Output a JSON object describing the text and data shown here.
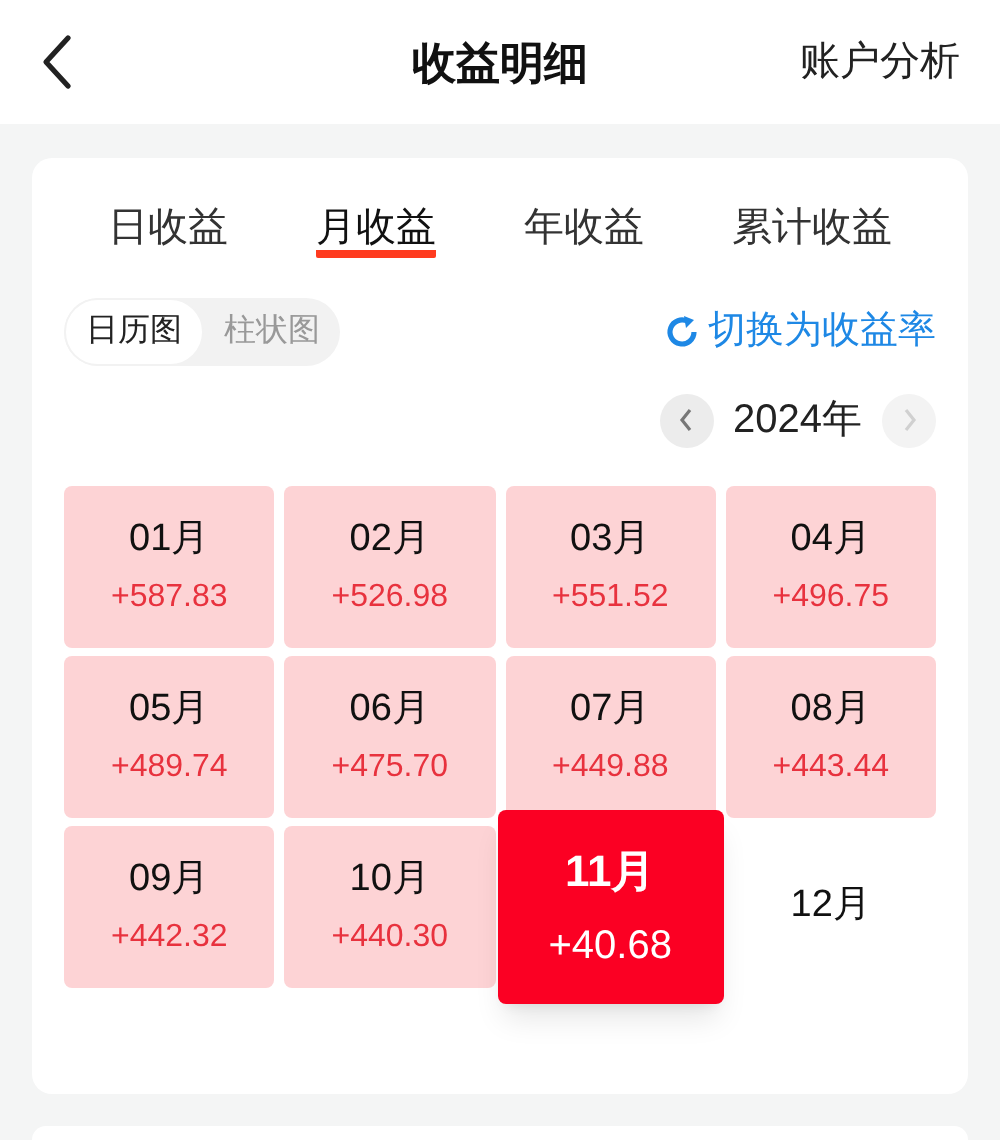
{
  "header": {
    "title": "收益明细",
    "action": "账户分析"
  },
  "tabs": [
    {
      "label": "日收益",
      "selected": false
    },
    {
      "label": "月收益",
      "selected": true
    },
    {
      "label": "年收益",
      "selected": false
    },
    {
      "label": "累计收益",
      "selected": false
    }
  ],
  "view_toggle": [
    {
      "label": "日历图",
      "selected": true
    },
    {
      "label": "柱状图",
      "selected": false
    }
  ],
  "switch_link": "切换为收益率",
  "year_nav": {
    "year": "2024年",
    "next_disabled": true
  },
  "months": [
    {
      "label": "01月",
      "value": "+587.83",
      "selected": false
    },
    {
      "label": "02月",
      "value": "+526.98",
      "selected": false
    },
    {
      "label": "03月",
      "value": "+551.52",
      "selected": false
    },
    {
      "label": "04月",
      "value": "+496.75",
      "selected": false
    },
    {
      "label": "05月",
      "value": "+489.74",
      "selected": false
    },
    {
      "label": "06月",
      "value": "+475.70",
      "selected": false
    },
    {
      "label": "07月",
      "value": "+449.88",
      "selected": false
    },
    {
      "label": "08月",
      "value": "+443.44",
      "selected": false
    },
    {
      "label": "09月",
      "value": "+442.32",
      "selected": false
    },
    {
      "label": "10月",
      "value": "+440.30",
      "selected": false
    },
    {
      "label": "11月",
      "value": "+40.68",
      "selected": true
    },
    {
      "label": "12月",
      "selected": false
    }
  ]
}
